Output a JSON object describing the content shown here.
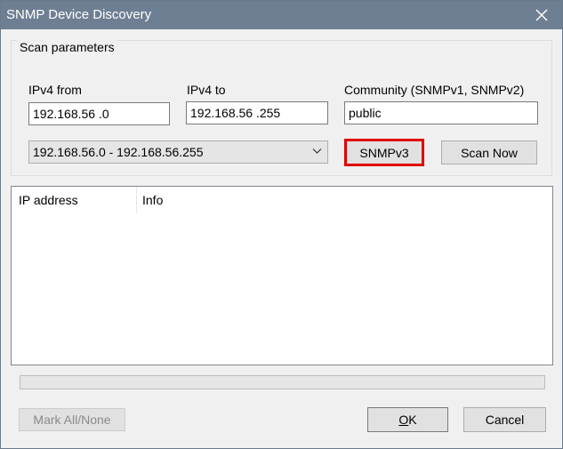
{
  "window": {
    "title": "SNMP Device Discovery"
  },
  "scan_params": {
    "group_label": "Scan parameters",
    "ipv4_from": {
      "label": "IPv4 from",
      "value": "192.168.56 .0"
    },
    "ipv4_to": {
      "label": "IPv4 to",
      "value": "192.168.56 .255"
    },
    "community": {
      "label": "Community (SNMPv1, SNMPv2)",
      "value": "public"
    },
    "range_select": {
      "selected": "192.168.56.0 - 192.168.56.255"
    },
    "snmpv3_label": "SNMPv3",
    "scan_now_label": "Scan Now"
  },
  "results": {
    "columns": [
      "IP address",
      "Info"
    ],
    "rows": []
  },
  "progress": {
    "fraction": 0
  },
  "footer": {
    "mark_all_label": "Mark All/None",
    "ok_label_first": "O",
    "ok_label_rest": "K",
    "cancel_label": "Cancel"
  },
  "colors": {
    "titlebar": "#6f7f93",
    "highlight": "#e00000"
  }
}
